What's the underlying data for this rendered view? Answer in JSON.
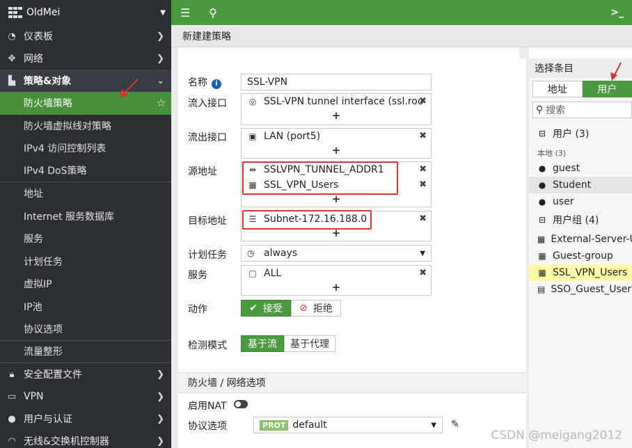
{
  "sidebar": {
    "brand": "OldMei",
    "items": [
      {
        "label": "仪表板",
        "icon": "dashboard-icon"
      },
      {
        "label": "网络",
        "icon": "network-icon"
      },
      {
        "label": "策略&对象",
        "icon": "policy-icon"
      }
    ],
    "policy_subitems": [
      "防火墙策略",
      "防火墙虚拟线对策略",
      "IPv4 访问控制列表",
      "IPv4 DoS策略",
      "地址",
      "Internet 服务数据库",
      "服务",
      "计划任务",
      "虚拟IP",
      "IP池",
      "协议选项",
      "流量整形"
    ],
    "bottom_items": [
      {
        "label": "安全配置文件",
        "icon": "lock-icon"
      },
      {
        "label": "VPN",
        "icon": "laptop-icon"
      },
      {
        "label": "用户与认证",
        "icon": "user-icon"
      },
      {
        "label": "无线&交换机控制器",
        "icon": "wifi-icon"
      }
    ]
  },
  "header": {
    "page_title": "新建建策略",
    "right_icon": ">_"
  },
  "form": {
    "name_label": "名称",
    "name_value": "SSL-VPN",
    "in_iface_label": "流入接口",
    "in_iface_value": "SSL-VPN tunnel interface (ssl.roo",
    "out_iface_label": "流出接口",
    "out_iface_value": "LAN (port5)",
    "src_label": "源地址",
    "src_values": [
      "SSLVPN_TUNNEL_ADDR1",
      "SSL_VPN_Users"
    ],
    "dst_label": "目标地址",
    "dst_value": "Subnet-172.16.188.0",
    "schedule_label": "计划任务",
    "schedule_value": "always",
    "service_label": "服务",
    "service_value": "ALL",
    "action_label": "动作",
    "accept_label": "接受",
    "deny_label": "拒绝",
    "inspect_label": "检测模式",
    "flow_label": "基于流",
    "proxy_label": "基于代理",
    "section_title": "防火墙 / 网络选项",
    "nat_label": "启用NAT",
    "proto_label": "协议选项",
    "proto_badge": "PROT",
    "proto_value": "default",
    "plus": "+"
  },
  "right_panel": {
    "title": "选择条目",
    "tab_address": "地址",
    "tab_user": "用户",
    "search_placeholder": "搜索",
    "users_header": "用户 (3)",
    "local_header": "本地 (3)",
    "users": [
      "guest",
      "Student",
      "user"
    ],
    "groups_header": "用户组 (4)",
    "groups": [
      "External-Server-U",
      "Guest-group",
      "SSL_VPN_Users",
      "SSO_Guest_Users"
    ]
  },
  "watermark": "CSDN @meigang2012",
  "colors": {
    "accent": "#4b9a3f",
    "sidebar": "#2c2f33",
    "annotation": "#d93535"
  }
}
